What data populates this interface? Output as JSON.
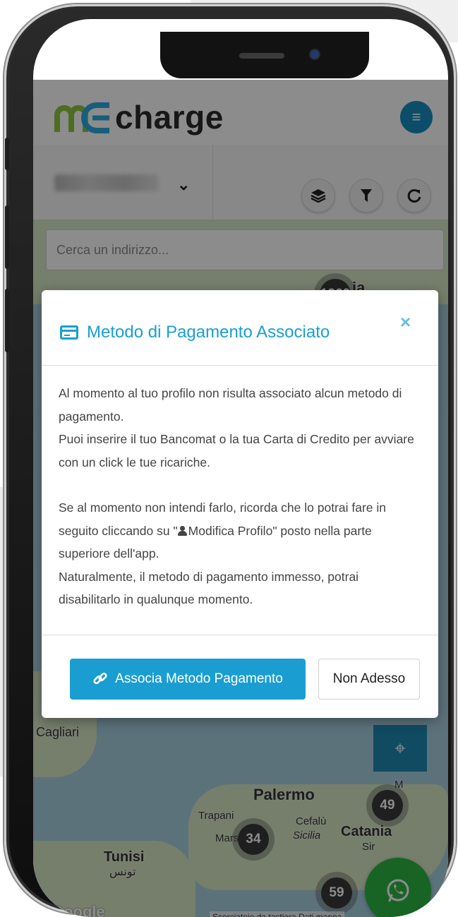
{
  "app": {
    "logo_text": "charge",
    "brand_colors": {
      "primary": "#1a9ed2",
      "logo_green": "#8dc63f",
      "logo_blue": "#29abe2"
    }
  },
  "toolbar": {
    "select_chevron": "⌄",
    "buttons": [
      {
        "icon": "layers-icon"
      },
      {
        "icon": "filter-icon"
      },
      {
        "icon": "refresh-icon"
      }
    ]
  },
  "map": {
    "search_placeholder": "Cerca un indirizzo...",
    "clusters": [
      "1260",
      "49",
      "34",
      "59"
    ],
    "labels": {
      "cagliari": "Cagliari",
      "palermo": "Palermo",
      "trapani": "Trapani",
      "cefalu": "Cefalù",
      "sicilia": "Sicilia",
      "catania": "Catania",
      "marsala": "Mars",
      "messina": "M",
      "tunisi": "Tunisi",
      "tunisi_ar": "تونس",
      "sir": "Sir",
      "ia": "ia"
    },
    "attribution": "Scorciatoie da tastiera   Dati mappa",
    "google_logo": "Google"
  },
  "modal": {
    "title": "Metodo di Pagamento Associato",
    "close_symbol": "×",
    "body": {
      "p1": "Al momento al tuo profilo non risulta associato alcun metodo di pagamento.",
      "p2": "Puoi inserire il tuo Bancomat o la tua Carta di Credito per avviare con un click le tue ricariche.",
      "p3_before": "Se al momento non intendi farlo, ricorda che lo potrai fare in seguito cliccando su \"",
      "p3_link": "Modifica Profilo",
      "p3_after": "\" posto nella parte superiore dell'app.",
      "p4": "Naturalmente, il metodo di pagamento immesso, potrai disabilitarlo in qualunque momento."
    },
    "primary_button": "Associa Metodo Pagamento",
    "secondary_button": "Non Adesso"
  }
}
